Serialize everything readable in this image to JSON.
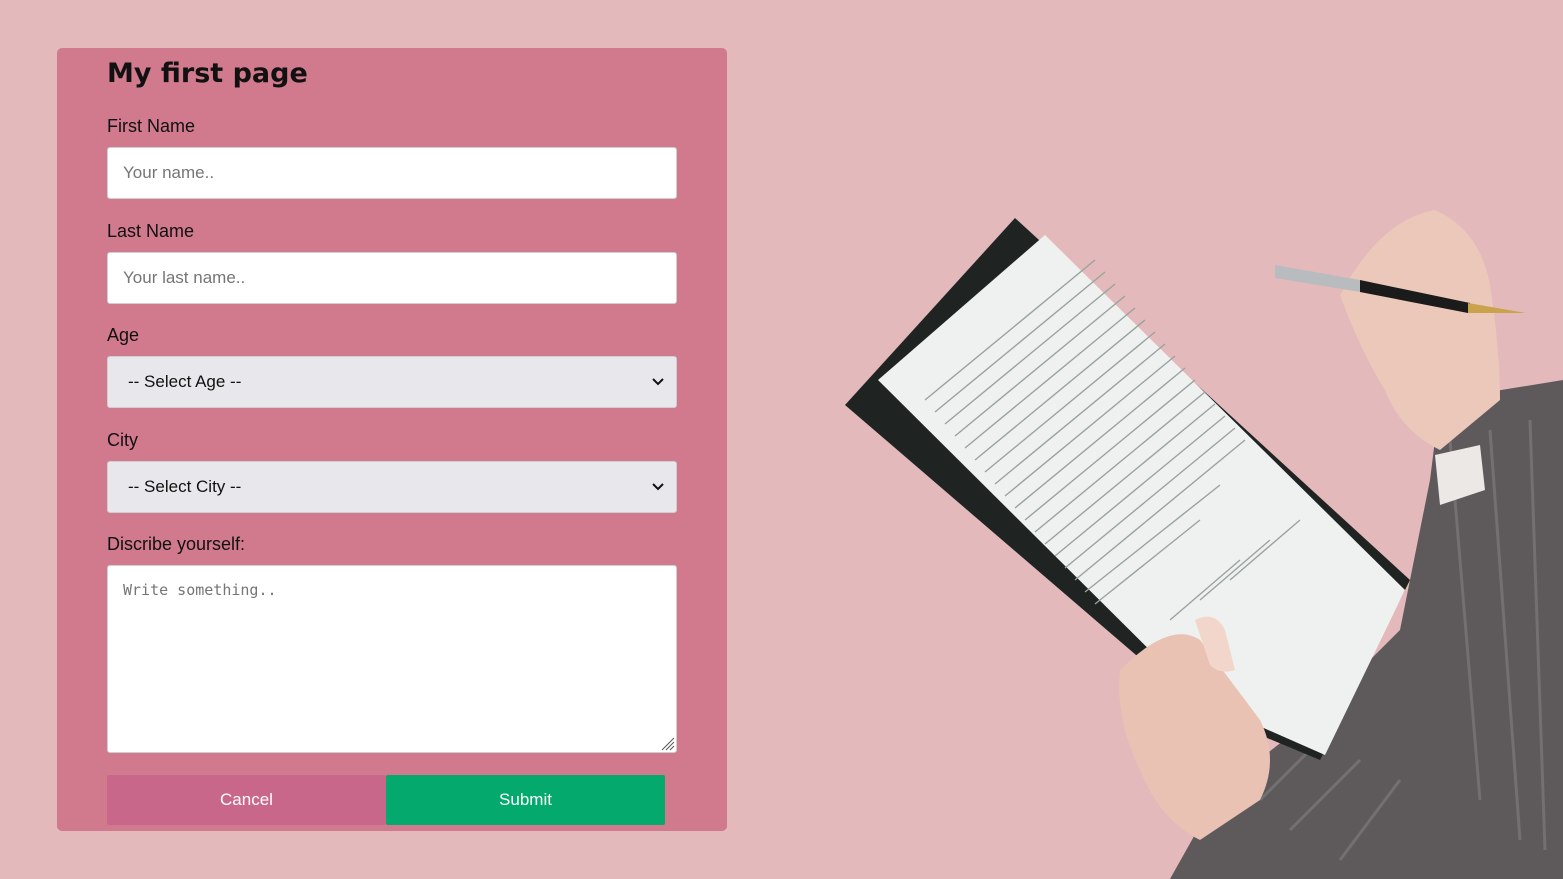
{
  "form": {
    "title": "My first page",
    "first_name": {
      "label": "First Name",
      "placeholder": "Your name.."
    },
    "last_name": {
      "label": "Last Name",
      "placeholder": "Your last name.."
    },
    "age": {
      "label": "Age",
      "selected": "-- Select Age --"
    },
    "city": {
      "label": "City",
      "selected": "-- Select City --"
    },
    "description": {
      "label": "Discribe yourself:",
      "placeholder": "Write something.."
    },
    "cancel_label": "Cancel",
    "submit_label": "Submit"
  },
  "colors": {
    "page_background": "#e3b9bb",
    "card_background": "#d1798d",
    "cancel_button": "#c9678a",
    "submit_button": "#03a96d"
  },
  "illustration": {
    "icon": "clipboard-document-hand-pen-photo"
  }
}
